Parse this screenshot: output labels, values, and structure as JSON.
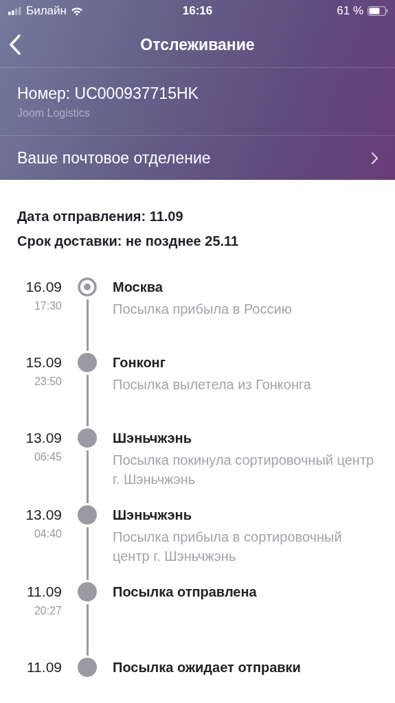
{
  "status_bar": {
    "carrier": "Билайн",
    "time": "16:16",
    "battery": "61 %"
  },
  "nav": {
    "title": "Отслеживание"
  },
  "tracking": {
    "number": "Номер: UC000937715HK",
    "carrier": "Joom Logistics"
  },
  "post_office": {
    "label": "Ваше почтовое отделение"
  },
  "info": [
    "Дата отправления: 11.09",
    "Срок доставки: не позднее 25.11"
  ],
  "events": [
    {
      "date": "16.09",
      "time": "17:30",
      "title": "Москва",
      "description": "Посылка прибыла в Россию",
      "current": true
    },
    {
      "date": "15.09",
      "time": "23:50",
      "title": "Гонконг",
      "description": "Посылка вылетела из Гонконга",
      "current": false
    },
    {
      "date": "13.09",
      "time": "06:45",
      "title": "Шэньчжэнь",
      "description": "Посылка покинула сортировочный центр г. Шэньчжэнь",
      "current": false
    },
    {
      "date": "13.09",
      "time": "04:40",
      "title": "Шэньчжэнь",
      "description": "Посылка прибыла в сортировочный центр г. Шэньчжэнь",
      "current": false
    },
    {
      "date": "11.09",
      "time": "20:27",
      "title": "Посылка отправлена",
      "current": false
    },
    {
      "date": "11.09",
      "title": "Посылка ожидает отправки",
      "current": false
    }
  ]
}
